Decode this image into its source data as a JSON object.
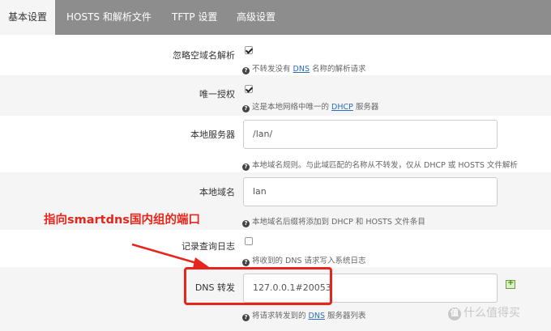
{
  "tabs": [
    {
      "label": "基本设置",
      "active": true
    },
    {
      "label": "HOSTS 和解析文件",
      "active": false
    },
    {
      "label": "TFTP 设置",
      "active": false
    },
    {
      "label": "高级设置",
      "active": false
    }
  ],
  "fields": {
    "domain_needed": {
      "label": "忽略空域名解析",
      "checked": true,
      "help_pre": "不转发没有 ",
      "help_link": "DNS",
      "help_post": " 名称的解析请求"
    },
    "authoritative": {
      "label": "唯一授权",
      "checked": true,
      "help_pre": "这是本地网络中唯一的 ",
      "help_link": "DHCP",
      "help_post": " 服务器"
    },
    "local_server": {
      "label": "本地服务器",
      "value": "/lan/",
      "help": "本地域名规则。与此域匹配的名称从不转发，仅从 DHCP 或 HOSTS 文件解析"
    },
    "local_domain": {
      "label": "本地域名",
      "value": "lan",
      "help": "本地域名后缀将添加到 DHCP 和 HOSTS 文件条目"
    },
    "log_queries": {
      "label": "记录查询日志",
      "checked": false,
      "help": "将收到的 DNS 请求写入系统日志"
    },
    "dns_forward": {
      "label": "DNS 转发",
      "value": "127.0.0.1#20053",
      "help_pre": "将请求转发到的 ",
      "help_link": "DNS",
      "help_post": " 服务器列表"
    }
  },
  "annotation": {
    "text": "指向smartdns国内组的端口",
    "color": "#e8251c"
  },
  "watermark": {
    "glyph": "值",
    "text": "什么值得买"
  },
  "colors": {
    "tab_bar": "#8d8d8d",
    "row_alt": "#f5f5f5",
    "link": "#2a6fba",
    "annotation_red": "#e8251c"
  }
}
